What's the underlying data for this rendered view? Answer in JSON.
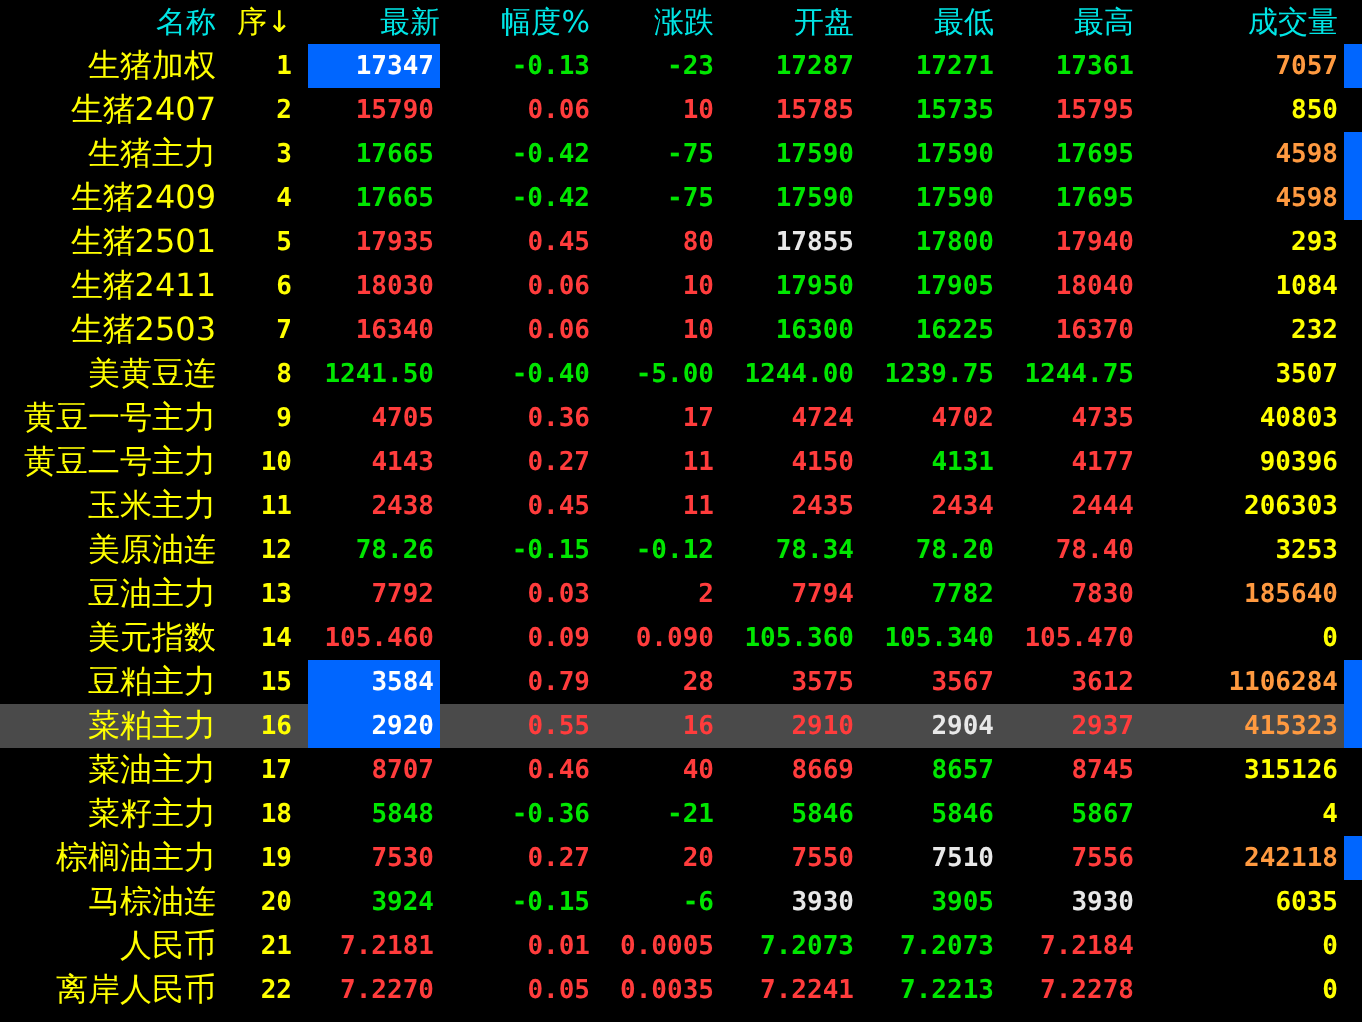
{
  "columns": [
    {
      "label": "名称",
      "sorted": false
    },
    {
      "label": "序↓",
      "sorted": true
    },
    {
      "label": "最新",
      "sorted": false
    },
    {
      "label": "幅度%",
      "sorted": false
    },
    {
      "label": "涨跌",
      "sorted": false
    },
    {
      "label": "开盘",
      "sorted": false
    },
    {
      "label": "最低",
      "sorted": false
    },
    {
      "label": "最高",
      "sorted": false
    },
    {
      "label": "成交量",
      "sorted": false
    }
  ],
  "rows": [
    {
      "name": "生猪加权",
      "seq": "1",
      "selected": false,
      "highlighted": true,
      "marked": true,
      "cells": [
        {
          "text": "17347"
        },
        {
          "text": "-0.13",
          "color": "#00e600"
        },
        {
          "text": "-23",
          "color": "#00e600"
        },
        {
          "text": "17287",
          "color": "#00e600"
        },
        {
          "text": "17271",
          "color": "#00e600"
        },
        {
          "text": "17361",
          "color": "#00e600"
        }
      ],
      "volume": {
        "text": "7057",
        "color": "#ff9a40"
      }
    },
    {
      "name": "生猪2407",
      "seq": "2",
      "selected": false,
      "highlighted": false,
      "marked": false,
      "cells": [
        {
          "text": "15790",
          "color": "#ff3c3c"
        },
        {
          "text": "0.06",
          "color": "#ff3c3c"
        },
        {
          "text": "10",
          "color": "#ff3c3c"
        },
        {
          "text": "15785",
          "color": "#ff3c3c"
        },
        {
          "text": "15735",
          "color": "#00e600"
        },
        {
          "text": "15795",
          "color": "#ff3c3c"
        }
      ],
      "volume": {
        "text": "850",
        "color": "#ffff00"
      }
    },
    {
      "name": "生猪主力",
      "seq": "3",
      "selected": false,
      "highlighted": false,
      "marked": true,
      "cells": [
        {
          "text": "17665",
          "color": "#00e600"
        },
        {
          "text": "-0.42",
          "color": "#00e600"
        },
        {
          "text": "-75",
          "color": "#00e600"
        },
        {
          "text": "17590",
          "color": "#00e600"
        },
        {
          "text": "17590",
          "color": "#00e600"
        },
        {
          "text": "17695",
          "color": "#00e600"
        }
      ],
      "volume": {
        "text": "4598",
        "color": "#ff9a40"
      }
    },
    {
      "name": "生猪2409",
      "seq": "4",
      "selected": false,
      "highlighted": false,
      "marked": true,
      "cells": [
        {
          "text": "17665",
          "color": "#00e600"
        },
        {
          "text": "-0.42",
          "color": "#00e600"
        },
        {
          "text": "-75",
          "color": "#00e600"
        },
        {
          "text": "17590",
          "color": "#00e600"
        },
        {
          "text": "17590",
          "color": "#00e600"
        },
        {
          "text": "17695",
          "color": "#00e600"
        }
      ],
      "volume": {
        "text": "4598",
        "color": "#ff9a40"
      }
    },
    {
      "name": "生猪2501",
      "seq": "5",
      "selected": false,
      "highlighted": false,
      "marked": false,
      "cells": [
        {
          "text": "17935",
          "color": "#ff3c3c"
        },
        {
          "text": "0.45",
          "color": "#ff3c3c"
        },
        {
          "text": "80",
          "color": "#ff3c3c"
        },
        {
          "text": "17855",
          "color": "#e8e8e8"
        },
        {
          "text": "17800",
          "color": "#00e600"
        },
        {
          "text": "17940",
          "color": "#ff3c3c"
        }
      ],
      "volume": {
        "text": "293",
        "color": "#ffff00"
      }
    },
    {
      "name": "生猪2411",
      "seq": "6",
      "selected": false,
      "highlighted": false,
      "marked": false,
      "cells": [
        {
          "text": "18030",
          "color": "#ff3c3c"
        },
        {
          "text": "0.06",
          "color": "#ff3c3c"
        },
        {
          "text": "10",
          "color": "#ff3c3c"
        },
        {
          "text": "17950",
          "color": "#00e600"
        },
        {
          "text": "17905",
          "color": "#00e600"
        },
        {
          "text": "18040",
          "color": "#ff3c3c"
        }
      ],
      "volume": {
        "text": "1084",
        "color": "#ffff00"
      }
    },
    {
      "name": "生猪2503",
      "seq": "7",
      "selected": false,
      "highlighted": false,
      "marked": false,
      "cells": [
        {
          "text": "16340",
          "color": "#ff3c3c"
        },
        {
          "text": "0.06",
          "color": "#ff3c3c"
        },
        {
          "text": "10",
          "color": "#ff3c3c"
        },
        {
          "text": "16300",
          "color": "#00e600"
        },
        {
          "text": "16225",
          "color": "#00e600"
        },
        {
          "text": "16370",
          "color": "#ff3c3c"
        }
      ],
      "volume": {
        "text": "232",
        "color": "#ffff00"
      }
    },
    {
      "name": "美黄豆连",
      "seq": "8",
      "selected": false,
      "highlighted": false,
      "marked": false,
      "cells": [
        {
          "text": "1241.50",
          "color": "#00e600"
        },
        {
          "text": "-0.40",
          "color": "#00e600"
        },
        {
          "text": "-5.00",
          "color": "#00e600"
        },
        {
          "text": "1244.00",
          "color": "#00e600"
        },
        {
          "text": "1239.75",
          "color": "#00e600"
        },
        {
          "text": "1244.75",
          "color": "#00e600"
        }
      ],
      "volume": {
        "text": "3507",
        "color": "#ffff00"
      }
    },
    {
      "name": "黄豆一号主力",
      "seq": "9",
      "selected": false,
      "highlighted": false,
      "marked": false,
      "cells": [
        {
          "text": "4705",
          "color": "#ff3c3c"
        },
        {
          "text": "0.36",
          "color": "#ff3c3c"
        },
        {
          "text": "17",
          "color": "#ff3c3c"
        },
        {
          "text": "4724",
          "color": "#ff3c3c"
        },
        {
          "text": "4702",
          "color": "#ff3c3c"
        },
        {
          "text": "4735",
          "color": "#ff3c3c"
        }
      ],
      "volume": {
        "text": "40803",
        "color": "#ffff00"
      }
    },
    {
      "name": "黄豆二号主力",
      "seq": "10",
      "selected": false,
      "highlighted": false,
      "marked": false,
      "cells": [
        {
          "text": "4143",
          "color": "#ff3c3c"
        },
        {
          "text": "0.27",
          "color": "#ff3c3c"
        },
        {
          "text": "11",
          "color": "#ff3c3c"
        },
        {
          "text": "4150",
          "color": "#ff3c3c"
        },
        {
          "text": "4131",
          "color": "#00e600"
        },
        {
          "text": "4177",
          "color": "#ff3c3c"
        }
      ],
      "volume": {
        "text": "90396",
        "color": "#ffff00"
      }
    },
    {
      "name": "玉米主力",
      "seq": "11",
      "selected": false,
      "highlighted": false,
      "marked": false,
      "cells": [
        {
          "text": "2438",
          "color": "#ff3c3c"
        },
        {
          "text": "0.45",
          "color": "#ff3c3c"
        },
        {
          "text": "11",
          "color": "#ff3c3c"
        },
        {
          "text": "2435",
          "color": "#ff3c3c"
        },
        {
          "text": "2434",
          "color": "#ff3c3c"
        },
        {
          "text": "2444",
          "color": "#ff3c3c"
        }
      ],
      "volume": {
        "text": "206303",
        "color": "#ffff00"
      }
    },
    {
      "name": "美原油连",
      "seq": "12",
      "selected": false,
      "highlighted": false,
      "marked": false,
      "cells": [
        {
          "text": "78.26",
          "color": "#00e600"
        },
        {
          "text": "-0.15",
          "color": "#00e600"
        },
        {
          "text": "-0.12",
          "color": "#00e600"
        },
        {
          "text": "78.34",
          "color": "#00e600"
        },
        {
          "text": "78.20",
          "color": "#00e600"
        },
        {
          "text": "78.40",
          "color": "#ff3c3c"
        }
      ],
      "volume": {
        "text": "3253",
        "color": "#ffff00"
      }
    },
    {
      "name": "豆油主力",
      "seq": "13",
      "selected": false,
      "highlighted": false,
      "marked": false,
      "cells": [
        {
          "text": "7792",
          "color": "#ff3c3c"
        },
        {
          "text": "0.03",
          "color": "#ff3c3c"
        },
        {
          "text": "2",
          "color": "#ff3c3c"
        },
        {
          "text": "7794",
          "color": "#ff3c3c"
        },
        {
          "text": "7782",
          "color": "#00e600"
        },
        {
          "text": "7830",
          "color": "#ff3c3c"
        }
      ],
      "volume": {
        "text": "185640",
        "color": "#ff9a40"
      }
    },
    {
      "name": "美元指数",
      "seq": "14",
      "selected": false,
      "highlighted": false,
      "marked": false,
      "cells": [
        {
          "text": "105.460",
          "color": "#ff3c3c"
        },
        {
          "text": "0.09",
          "color": "#ff3c3c"
        },
        {
          "text": "0.090",
          "color": "#ff3c3c"
        },
        {
          "text": "105.360",
          "color": "#00e600"
        },
        {
          "text": "105.340",
          "color": "#00e600"
        },
        {
          "text": "105.470",
          "color": "#ff3c3c"
        }
      ],
      "volume": {
        "text": "0",
        "color": "#ffff00"
      }
    },
    {
      "name": "豆粕主力",
      "seq": "15",
      "selected": false,
      "highlighted": true,
      "marked": true,
      "cells": [
        {
          "text": "3584"
        },
        {
          "text": "0.79",
          "color": "#ff3c3c"
        },
        {
          "text": "28",
          "color": "#ff3c3c"
        },
        {
          "text": "3575",
          "color": "#ff3c3c"
        },
        {
          "text": "3567",
          "color": "#ff3c3c"
        },
        {
          "text": "3612",
          "color": "#ff3c3c"
        }
      ],
      "volume": {
        "text": "1106284",
        "color": "#ff9a40"
      }
    },
    {
      "name": "菜粕主力",
      "seq": "16",
      "selected": true,
      "highlighted": true,
      "marked": true,
      "cells": [
        {
          "text": "2920"
        },
        {
          "text": "0.55",
          "color": "#ff3c3c"
        },
        {
          "text": "16",
          "color": "#ff3c3c"
        },
        {
          "text": "2910",
          "color": "#ff3c3c"
        },
        {
          "text": "2904",
          "color": "#e8e8e8"
        },
        {
          "text": "2937",
          "color": "#ff3c3c"
        }
      ],
      "volume": {
        "text": "415323",
        "color": "#ff9a40"
      }
    },
    {
      "name": "菜油主力",
      "seq": "17",
      "selected": false,
      "highlighted": false,
      "marked": false,
      "cells": [
        {
          "text": "8707",
          "color": "#ff3c3c"
        },
        {
          "text": "0.46",
          "color": "#ff3c3c"
        },
        {
          "text": "40",
          "color": "#ff3c3c"
        },
        {
          "text": "8669",
          "color": "#ff3c3c"
        },
        {
          "text": "8657",
          "color": "#00e600"
        },
        {
          "text": "8745",
          "color": "#ff3c3c"
        }
      ],
      "volume": {
        "text": "315126",
        "color": "#ffff00"
      }
    },
    {
      "name": "菜籽主力",
      "seq": "18",
      "selected": false,
      "highlighted": false,
      "marked": false,
      "cells": [
        {
          "text": "5848",
          "color": "#00e600"
        },
        {
          "text": "-0.36",
          "color": "#00e600"
        },
        {
          "text": "-21",
          "color": "#00e600"
        },
        {
          "text": "5846",
          "color": "#00e600"
        },
        {
          "text": "5846",
          "color": "#00e600"
        },
        {
          "text": "5867",
          "color": "#00e600"
        }
      ],
      "volume": {
        "text": "4",
        "color": "#ffff00"
      }
    },
    {
      "name": "棕榈油主力",
      "seq": "19",
      "selected": false,
      "highlighted": false,
      "marked": true,
      "cells": [
        {
          "text": "7530",
          "color": "#ff3c3c"
        },
        {
          "text": "0.27",
          "color": "#ff3c3c"
        },
        {
          "text": "20",
          "color": "#ff3c3c"
        },
        {
          "text": "7550",
          "color": "#ff3c3c"
        },
        {
          "text": "7510",
          "color": "#e8e8e8"
        },
        {
          "text": "7556",
          "color": "#ff3c3c"
        }
      ],
      "volume": {
        "text": "242118",
        "color": "#ff9a40"
      }
    },
    {
      "name": "马棕油连",
      "seq": "20",
      "selected": false,
      "highlighted": false,
      "marked": false,
      "cells": [
        {
          "text": "3924",
          "color": "#00e600"
        },
        {
          "text": "-0.15",
          "color": "#00e600"
        },
        {
          "text": "-6",
          "color": "#00e600"
        },
        {
          "text": "3930",
          "color": "#e8e8e8"
        },
        {
          "text": "3905",
          "color": "#00e600"
        },
        {
          "text": "3930",
          "color": "#e8e8e8"
        }
      ],
      "volume": {
        "text": "6035",
        "color": "#ffff00"
      }
    },
    {
      "name": "人民币",
      "seq": "21",
      "selected": false,
      "highlighted": false,
      "marked": false,
      "cells": [
        {
          "text": "7.2181",
          "color": "#ff3c3c"
        },
        {
          "text": "0.01",
          "color": "#ff3c3c"
        },
        {
          "text": "0.0005",
          "color": "#ff3c3c"
        },
        {
          "text": "7.2073",
          "color": "#00e600"
        },
        {
          "text": "7.2073",
          "color": "#00e600"
        },
        {
          "text": "7.2184",
          "color": "#ff3c3c"
        }
      ],
      "volume": {
        "text": "0",
        "color": "#ffff00"
      }
    },
    {
      "name": "离岸人民币",
      "seq": "22",
      "selected": false,
      "highlighted": false,
      "marked": false,
      "cells": [
        {
          "text": "7.2270",
          "color": "#ff3c3c"
        },
        {
          "text": "0.05",
          "color": "#ff3c3c"
        },
        {
          "text": "0.0035",
          "color": "#ff3c3c"
        },
        {
          "text": "7.2241",
          "color": "#ff3c3c"
        },
        {
          "text": "7.2213",
          "color": "#00e600"
        },
        {
          "text": "7.2278",
          "color": "#ff3c3c"
        }
      ],
      "volume": {
        "text": "0",
        "color": "#ffff00"
      }
    }
  ]
}
